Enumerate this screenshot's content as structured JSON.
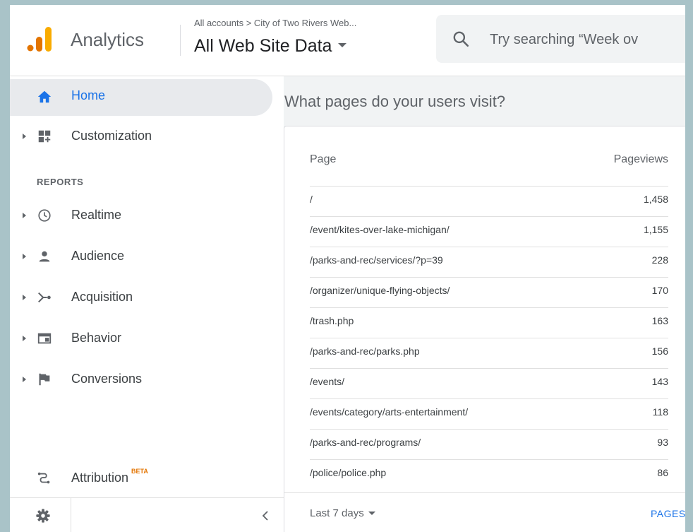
{
  "header": {
    "product_name": "Analytics",
    "breadcrumb": "All accounts > City of Two Rivers Web...",
    "view_name": "All Web Site Data",
    "search_placeholder": "Try searching “Week ov",
    "logo_colors": [
      "#f9ab00",
      "#e37400",
      "#e37400"
    ]
  },
  "sidebar": {
    "items": [
      {
        "label": "Home",
        "icon": "home-icon",
        "active": true
      },
      {
        "label": "Customization",
        "icon": "customization-icon"
      },
      {
        "label": "Realtime",
        "icon": "clock-icon"
      },
      {
        "label": "Audience",
        "icon": "person-icon"
      },
      {
        "label": "Acquisition",
        "icon": "acquisition-icon"
      },
      {
        "label": "Behavior",
        "icon": "behavior-icon"
      },
      {
        "label": "Conversions",
        "icon": "flag-icon"
      }
    ],
    "section_reports": "REPORTS",
    "attribution": {
      "label": "Attribution",
      "badge": "BETA"
    }
  },
  "main": {
    "question": "What pages do your users visit?",
    "table": {
      "col_page": "Page",
      "col_pageviews": "Pageviews",
      "rows": [
        {
          "page": "/",
          "pageviews": "1,458"
        },
        {
          "page": "/event/kites-over-lake-michigan/",
          "pageviews": "1,155"
        },
        {
          "page": "/parks-and-rec/services/?p=39",
          "pageviews": "228"
        },
        {
          "page": "/organizer/unique-flying-objects/",
          "pageviews": "170"
        },
        {
          "page": "/trash.php",
          "pageviews": "163"
        },
        {
          "page": "/parks-and-rec/parks.php",
          "pageviews": "156"
        },
        {
          "page": "/events/",
          "pageviews": "143"
        },
        {
          "page": "/events/category/arts-entertainment/",
          "pageviews": "118"
        },
        {
          "page": "/parks-and-rec/programs/",
          "pageviews": "93"
        },
        {
          "page": "/police/police.php",
          "pageviews": "86"
        }
      ]
    },
    "footer": {
      "date_range": "Last 7 days",
      "report_link": "PAGES"
    }
  },
  "colors": {
    "accent": "#1a73e8",
    "beta": "#e37400"
  }
}
